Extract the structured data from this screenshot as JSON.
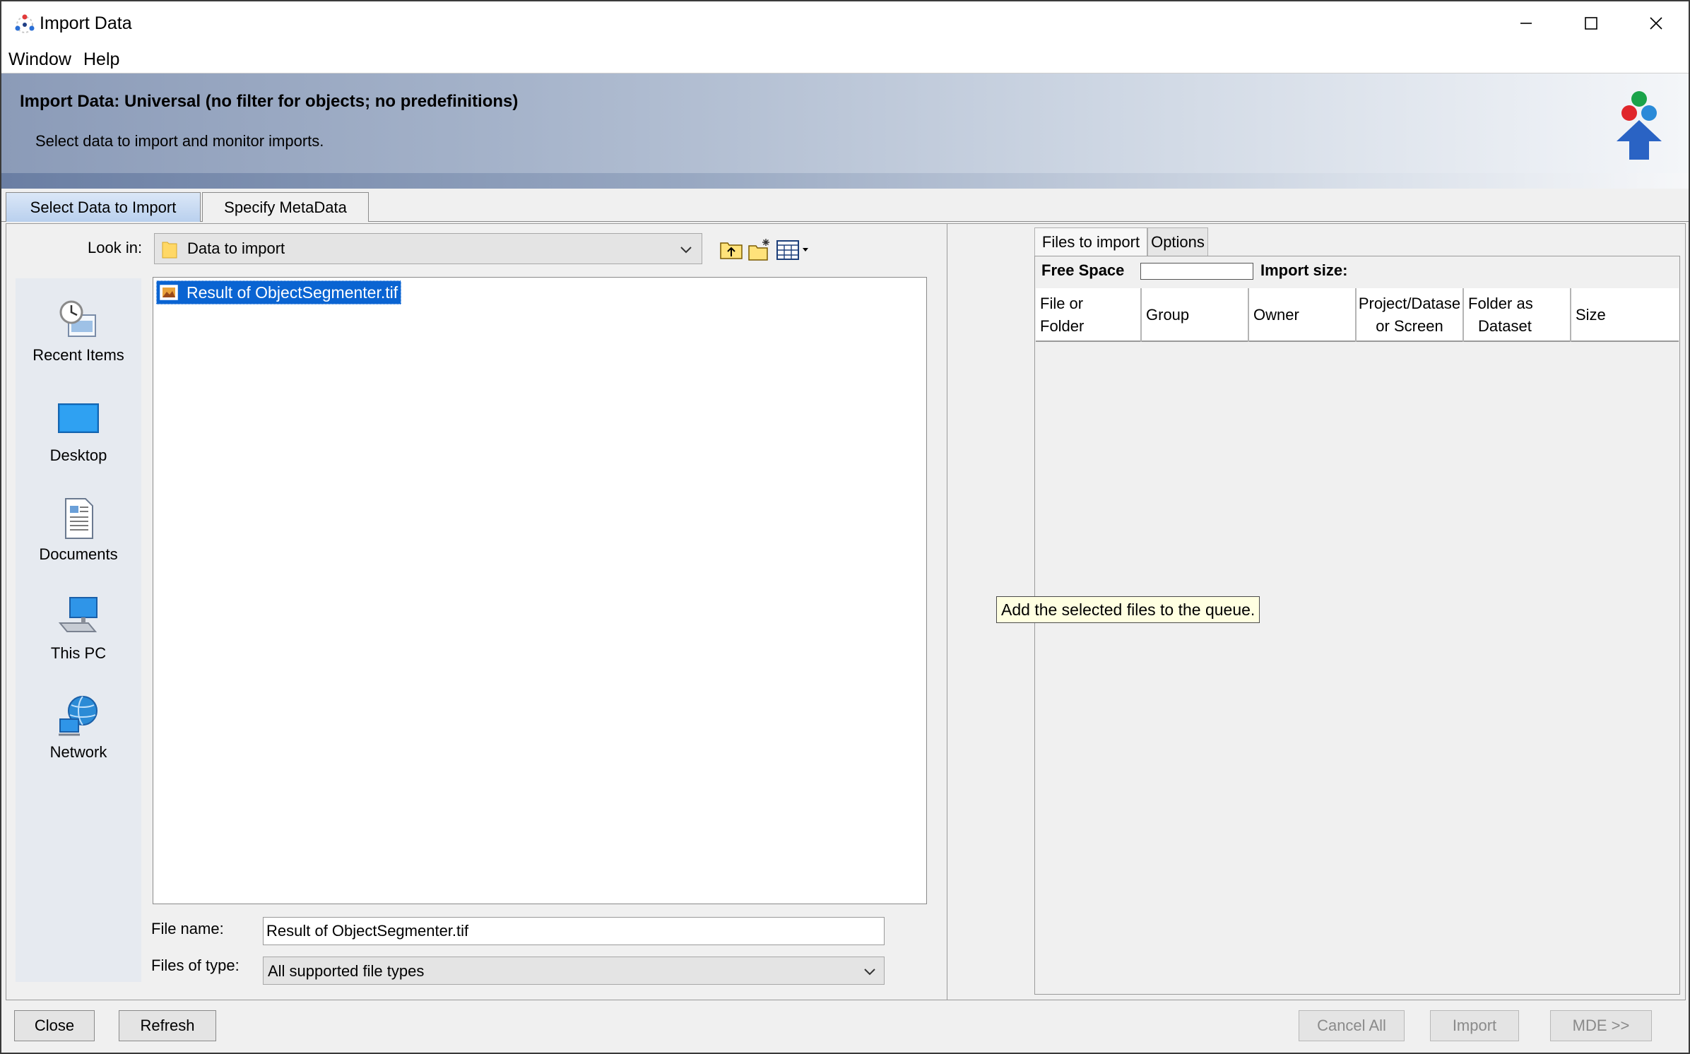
{
  "window": {
    "title": "Import Data",
    "controls": {
      "minimize": "minimize",
      "maximize": "maximize",
      "close": "close"
    }
  },
  "menu": [
    "Window",
    "Help"
  ],
  "banner": {
    "title": "Import Data: Universal (no filter for objects; no predefinitions)",
    "subtitle": "Select data to import and monitor imports."
  },
  "tabs": [
    "Select Data to Import",
    "Specify MetaData"
  ],
  "file_chooser": {
    "look_in_label": "Look in:",
    "look_in_value": "Data to import",
    "places": [
      "Recent Items",
      "Desktop",
      "Documents",
      "This PC",
      "Network"
    ],
    "files": [
      {
        "name": "Result of ObjectSegmenter.tif",
        "selected": true
      }
    ],
    "file_name_label": "File name:",
    "file_name_value": "Result of ObjectSegmenter.tif",
    "files_of_type_label": "Files of type:",
    "files_of_type_value": "All supported file types"
  },
  "transfer": {
    "tooltip": "Add the selected files to the queue."
  },
  "queue": {
    "tabs": [
      "Files to import",
      "Options"
    ],
    "free_space_label": "Free Space",
    "import_size_label": "Import size:",
    "columns": [
      [
        "File or",
        "Folder"
      ],
      [
        "Group"
      ],
      [
        "Owner"
      ],
      [
        "Project/Datase",
        "or Screen"
      ],
      [
        "Folder as",
        "Dataset"
      ],
      [
        "Size"
      ]
    ]
  },
  "buttons": {
    "close": "Close",
    "refresh": "Refresh",
    "cancel_all": "Cancel All",
    "import": "Import",
    "mde": "MDE >>"
  },
  "colors": {
    "selection": "#0a64d2",
    "tooltip_bg": "#ffffe1",
    "annotation_arrow": "#e8141b"
  }
}
